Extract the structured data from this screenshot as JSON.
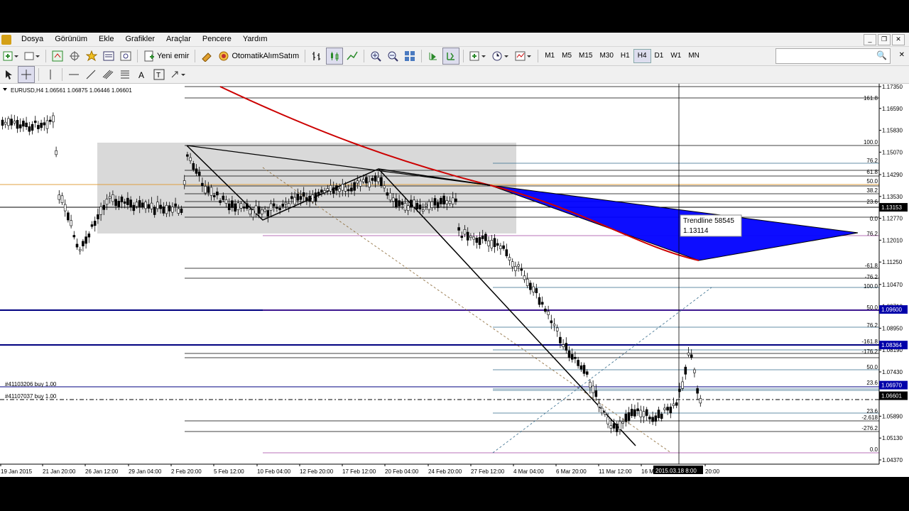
{
  "menu": [
    "Dosya",
    "Görünüm",
    "Ekle",
    "Grafikler",
    "Araçlar",
    "Pencere",
    "Yardım"
  ],
  "toolbar": {
    "new_order_label": "Yeni emir",
    "autotrade_label": "OtomatikAlımSatım",
    "timeframes": [
      "M1",
      "M5",
      "M15",
      "M30",
      "H1",
      "H4",
      "D1",
      "W1",
      "MN"
    ],
    "active_timeframe": "H4"
  },
  "chart": {
    "symbol_info": "EURUSD,H4  1.06561 1.06875 1.06446 1.06601",
    "price_labels": [
      "1.17350",
      "1.16590",
      "1.15830",
      "1.15070",
      "1.14290",
      "1.13530",
      "1.12770",
      "1.12010",
      "1.11250",
      "1.10470",
      "1.09710",
      "1.08950",
      "1.08190",
      "1.07430",
      "1.06670",
      "1.05890",
      "1.05130",
      "1.04370"
    ],
    "price_tags": [
      {
        "text": "1.13153",
        "color": "#000000"
      },
      {
        "text": "1.09600",
        "color": "#0000aa"
      },
      {
        "text": "1.08364",
        "color": "#0000aa"
      },
      {
        "text": "1.06970",
        "color": "#0000aa"
      },
      {
        "text": "1.06601",
        "color": "#000000"
      }
    ],
    "time_labels": [
      "19 Jan 2015",
      "21 Jan 20:00",
      "26 Jan 12:00",
      "29 Jan 04:00",
      "2 Feb 20:00",
      "5 Feb 12:00",
      "10 Feb 04:00",
      "12 Feb 20:00",
      "17 Feb 12:00",
      "20 Feb 04:00",
      "24 Feb 20:00",
      "27 Feb 12:00",
      "4 Mar 04:00",
      "6 Mar 20:00",
      "11 Mar 12:00",
      "16 M",
      "20:00"
    ],
    "crosshair_time": "2015.03.18 8:00",
    "tooltip": {
      "line1": "Trendline 58545",
      "line2": "1.13114"
    },
    "order_labels": [
      "#41103206 buy 1.00",
      "#41107037 buy 1.00"
    ],
    "fib_labels_upper": [
      "161.8",
      "100.0",
      "76.2",
      "61.8",
      "50.0",
      "38.2",
      "23.6",
      "0.0",
      "76.2",
      "-61.8",
      "-76.2",
      "100.0"
    ],
    "fib_labels_lower": [
      "50.0",
      "76.2",
      "-161.8",
      "-176.2",
      "50.0",
      "23.6",
      "23.6",
      "-2.618",
      "-276.2",
      "0.0"
    ],
    "colors": {
      "trend_red": "#cc0000",
      "fill_blue": "#0000ff",
      "navy": "#000080",
      "box": "#d9d9d9",
      "orange": "#e0a040"
    }
  }
}
